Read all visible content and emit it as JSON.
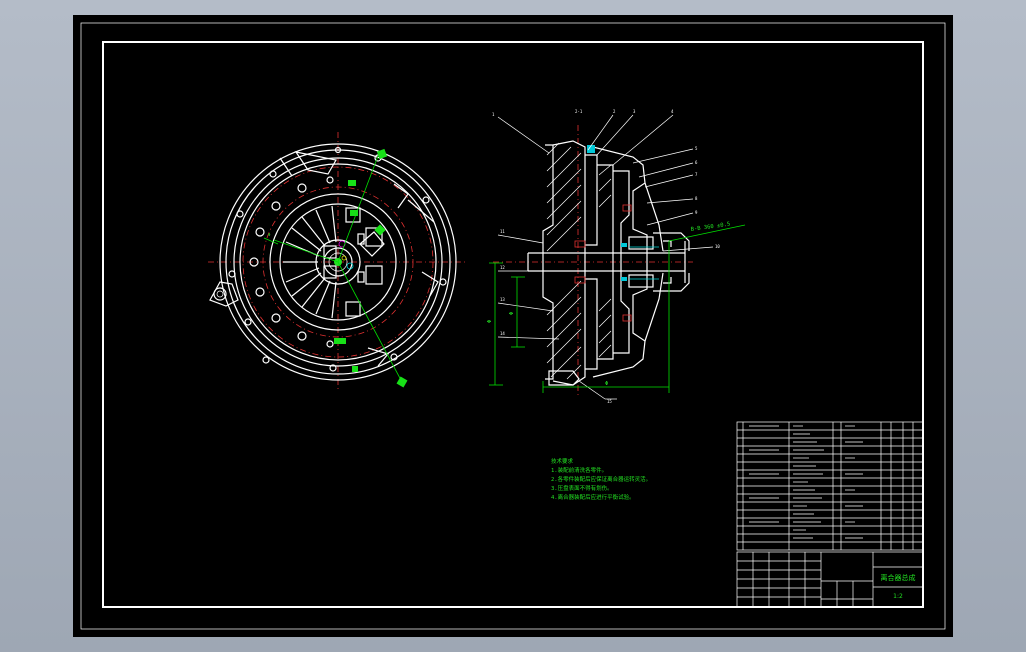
{
  "drawing": {
    "background_color": "#000000",
    "outer_bg_color": "#a9b1bd",
    "line_color": "#ffffff",
    "centerline_color": "#e03030",
    "dimension_color": "#00e000"
  },
  "section_view": {
    "dim_label": "B-B 360 ±0.5"
  },
  "technical_notes": {
    "lines": [
      "技术要求",
      "1.装配前清洗各零件。",
      "2.各零件装配后应保证离合器运转灵活。",
      "3.压盘表面不得有划伤。",
      "4.离合器装配后应进行平衡试验。"
    ]
  },
  "title_block": {
    "title": "离合器总成",
    "scale": "1:2"
  }
}
